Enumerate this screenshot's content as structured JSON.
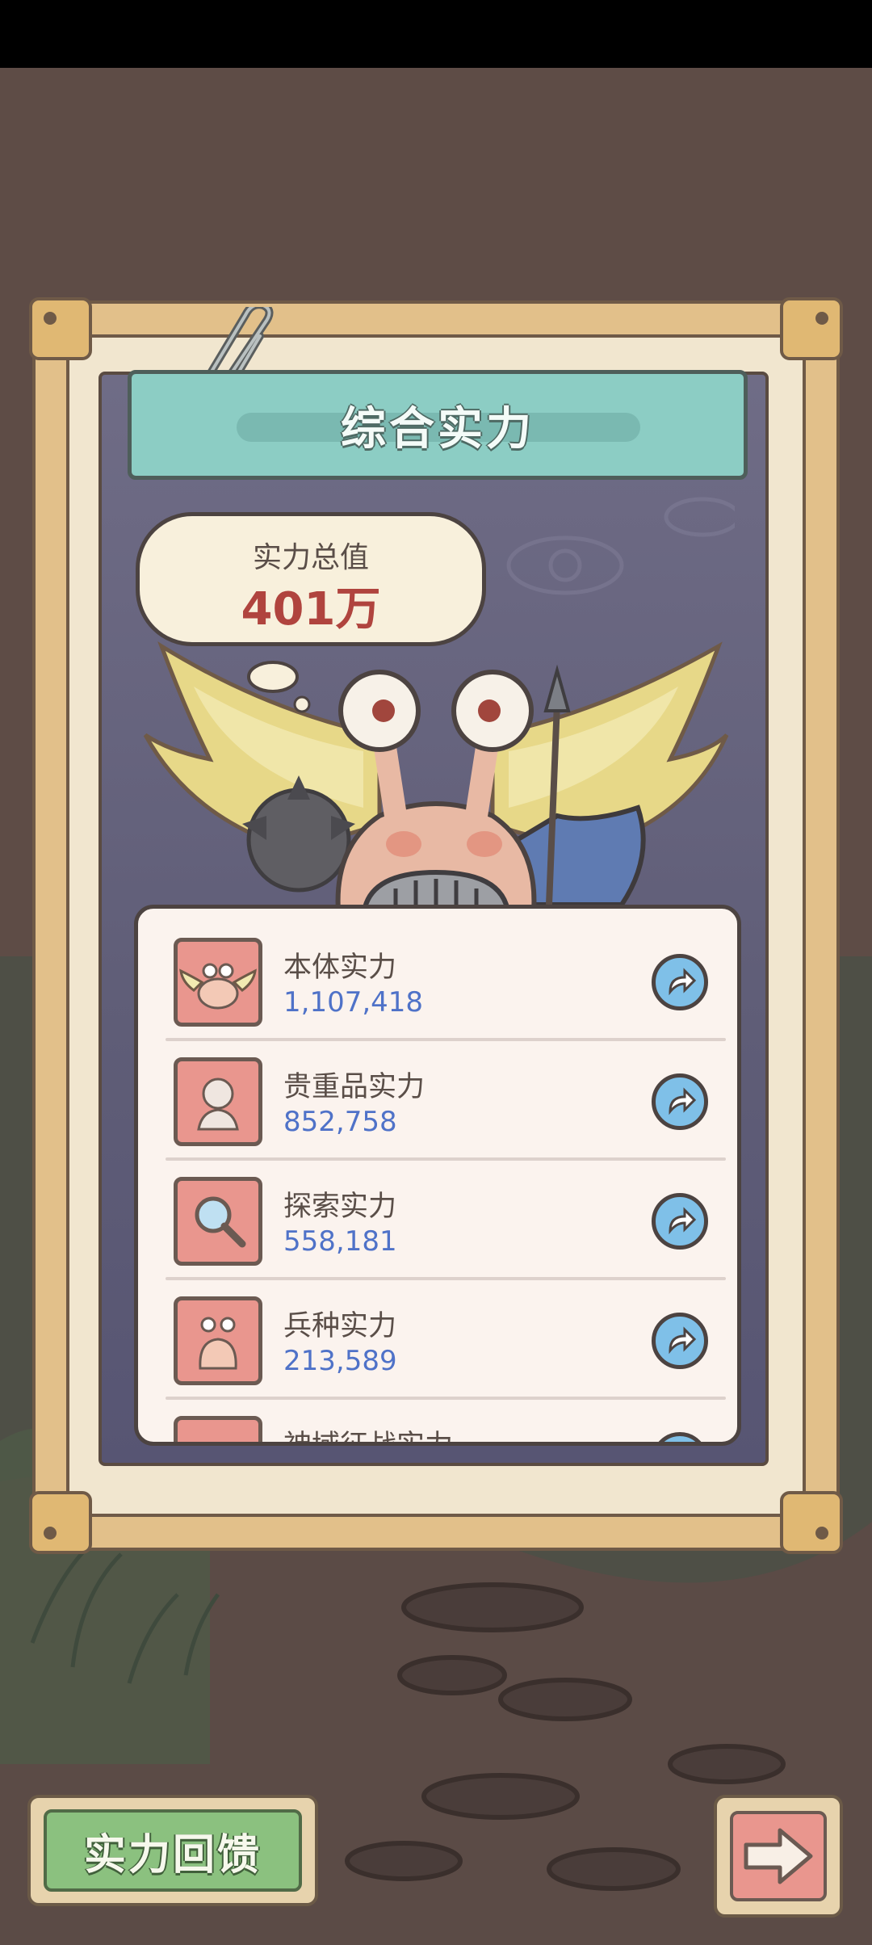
{
  "panel": {
    "title": "综合实力",
    "total_label": "实力总值",
    "total_value": "401万"
  },
  "rows": [
    {
      "name": "本体实力",
      "value": "1,107,418",
      "icon": "winged-snail-icon"
    },
    {
      "name": "贵重品实力",
      "value": "852,758",
      "icon": "bust-statue-icon"
    },
    {
      "name": "探索实力",
      "value": "558,181",
      "icon": "magnifier-icon"
    },
    {
      "name": "兵种实力",
      "value": "213,589",
      "icon": "snail-soldier-icon"
    },
    {
      "name": "神域征战实力",
      "value": "",
      "icon": "partial-icon"
    }
  ],
  "buttons": {
    "feedback": "实力回馈",
    "next_icon": "arrow-right-icon",
    "row_action_icon": "share-arrow-icon"
  },
  "colors": {
    "title_banner": "#8ccdc4",
    "value_red": "#b0443e",
    "value_blue": "#4f72c8",
    "icon_tile": "#e9968e",
    "feedback_green": "#8bc17f"
  }
}
